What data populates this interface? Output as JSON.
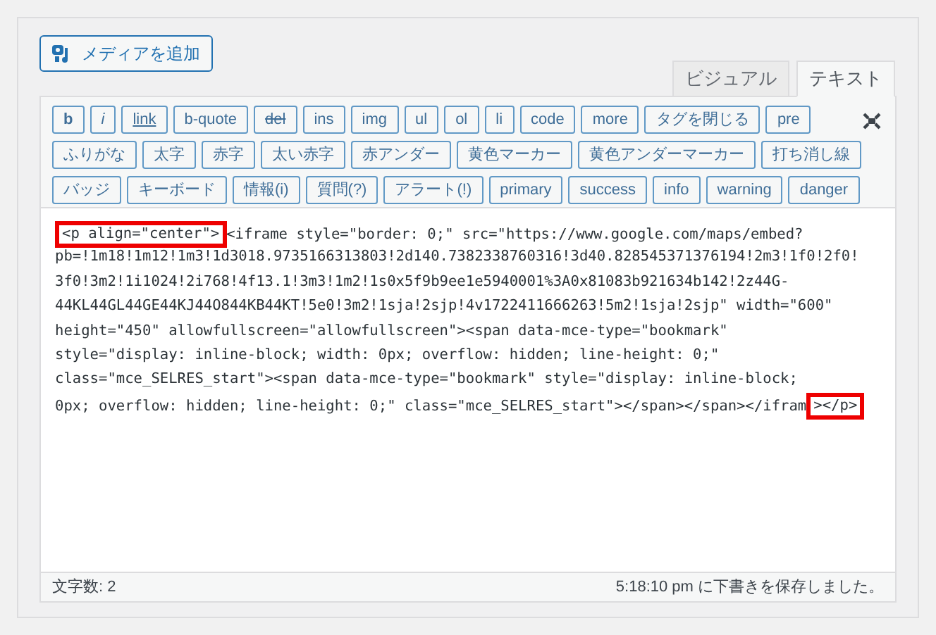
{
  "media_button": {
    "label": "メディアを追加"
  },
  "tabs": [
    {
      "label": "ビジュアル",
      "selected": false
    },
    {
      "label": "テキスト",
      "selected": true
    }
  ],
  "toolbar_rows": [
    [
      {
        "label": "b",
        "kind": "bold"
      },
      {
        "label": "i",
        "kind": "italic"
      },
      {
        "label": "link",
        "kind": "link"
      },
      {
        "label": "b-quote",
        "kind": "plain"
      },
      {
        "label": "del",
        "kind": "strike"
      },
      {
        "label": "ins",
        "kind": "plain"
      },
      {
        "label": "img",
        "kind": "plain"
      },
      {
        "label": "ul",
        "kind": "plain"
      },
      {
        "label": "ol",
        "kind": "plain"
      },
      {
        "label": "li",
        "kind": "plain"
      },
      {
        "label": "code",
        "kind": "plain"
      },
      {
        "label": "more",
        "kind": "plain"
      },
      {
        "label": "タグを閉じる",
        "kind": "plain"
      },
      {
        "label": "pre",
        "kind": "plain"
      }
    ],
    [
      {
        "label": "ふりがな",
        "kind": "plain"
      },
      {
        "label": "太字",
        "kind": "plain"
      },
      {
        "label": "赤字",
        "kind": "plain"
      },
      {
        "label": "太い赤字",
        "kind": "plain"
      },
      {
        "label": "赤アンダー",
        "kind": "plain"
      },
      {
        "label": "黄色マーカー",
        "kind": "plain"
      },
      {
        "label": "黄色アンダーマーカー",
        "kind": "plain"
      },
      {
        "label": "打ち消し線",
        "kind": "plain"
      }
    ],
    [
      {
        "label": "バッジ",
        "kind": "plain"
      },
      {
        "label": "キーボード",
        "kind": "plain"
      },
      {
        "label": "情報(i)",
        "kind": "plain"
      },
      {
        "label": "質問(?)",
        "kind": "plain"
      },
      {
        "label": "アラート(!)",
        "kind": "plain"
      },
      {
        "label": "primary",
        "kind": "plain"
      },
      {
        "label": "success",
        "kind": "plain"
      },
      {
        "label": "info",
        "kind": "plain"
      },
      {
        "label": "warning",
        "kind": "plain"
      },
      {
        "label": "danger",
        "kind": "plain"
      }
    ]
  ],
  "code_lines": [
    [
      {
        "text": "<p align=\"center\">",
        "highlighted": true
      },
      {
        "text": "<iframe style=\"border: 0;\" src=\"https://www.google.com/maps/embed?",
        "highlighted": false
      }
    ],
    [
      {
        "text": "pb=!1m18!1m12!1m3!1d3018.9735166313803!2d140.7382338760316!3d40.828545371376194!2m3!1f0!2f0!",
        "highlighted": false
      }
    ],
    [
      {
        "text": "3f0!3m2!1i1024!2i768!4f13.1!3m3!1m2!1s0x5f9b9ee1e5940001%3A0x81083b921634b142!2z44G-",
        "highlighted": false
      }
    ],
    [
      {
        "text": "44KL44GL44GE44KJ44O844KB44KT!5e0!3m2!1sja!2sjp!4v1722411666263!5m2!1sja!2sjp\" width=\"600\"",
        "highlighted": false
      }
    ],
    [
      {
        "text": "height=\"450\" allowfullscreen=\"allowfullscreen\"><span data-mce-type=\"bookmark\"",
        "highlighted": false
      }
    ],
    [
      {
        "text": "style=\"display: inline-block; width: 0px; overflow: hidden; line-height: 0;\"",
        "highlighted": false
      }
    ],
    [
      {
        "text": "class=\"mce_SELRES_start\"><span data-mce-type=\"bookmark\" style=\"display: inline-block;",
        "highlighted": false
      }
    ],
    [
      {
        "text": "0px; overflow: hidden; line-height: 0;\" class=\"mce_SELRES_start\"></span></span></ifram",
        "highlighted": false
      },
      {
        "text": "></p>",
        "highlighted": true
      }
    ]
  ],
  "status_bar": {
    "word_count": "文字数: 2",
    "save_status": "5:18:10 pm に下書きを保存しました。"
  }
}
